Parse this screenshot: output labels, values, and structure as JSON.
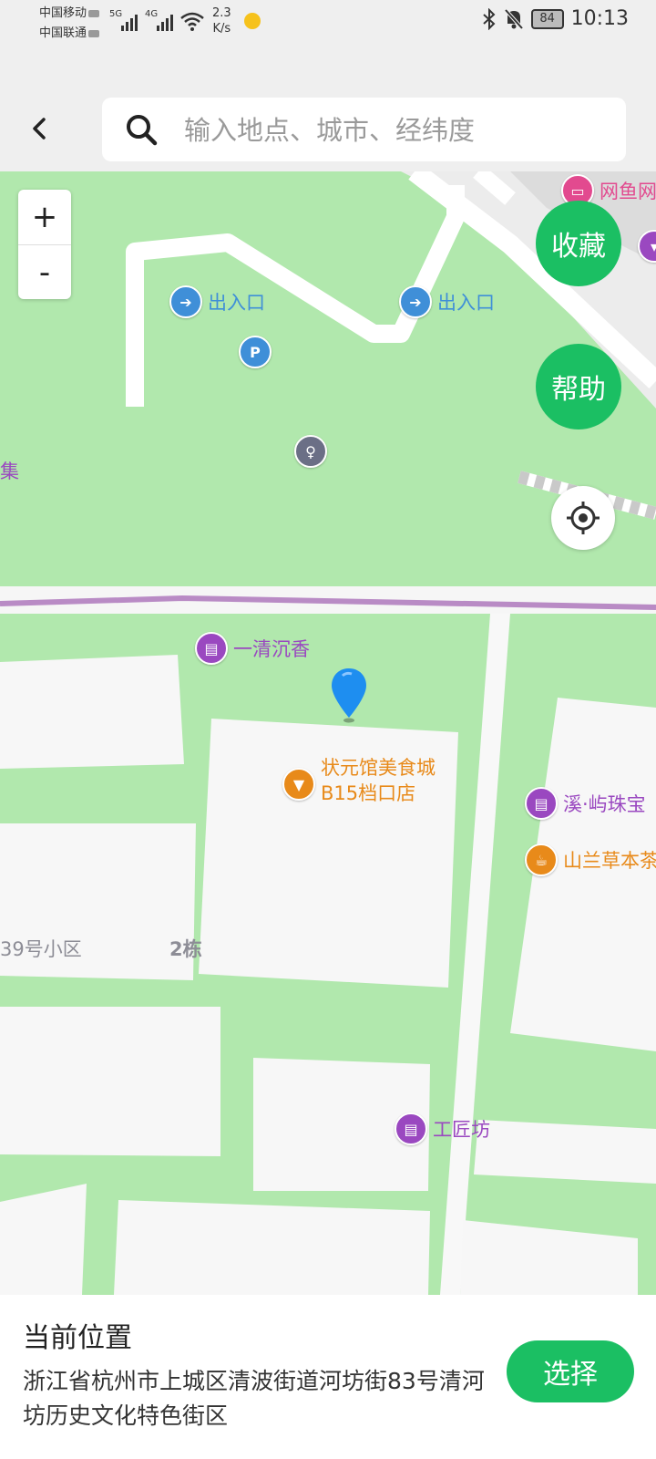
{
  "status_bar": {
    "carrier1": "中国移动",
    "carrier2": "中国联通",
    "sig1_label": "5G",
    "sig2_label": "4G",
    "speed_value": "2.3",
    "speed_unit": "K/s",
    "battery": "84",
    "time": "10:13"
  },
  "search": {
    "placeholder": "输入地点、城市、经纬度"
  },
  "map": {
    "zoom_in": "+",
    "zoom_out": "-",
    "favorite_label": "收藏",
    "help_label": "帮助",
    "pois": {
      "entrance1": "出入口",
      "entrance2": "出入口",
      "parking_glyph": "P",
      "market_partial": "集",
      "wangyu": "网鱼网",
      "yiqing": "一清沉香",
      "zhuangyuan_line1": "状元馆美食城",
      "zhuangyuan_line2": "B15档口店",
      "xiyu": "溪·屿珠宝",
      "shanlan": "山兰草本茶",
      "gongjiang": "工匠坊"
    },
    "labels": {
      "community": "39号小区",
      "building": "2栋"
    }
  },
  "bottom_panel": {
    "title": "当前位置",
    "address": "浙江省杭州市上城区清波街道河坊街83号清河坊历史文化特色街区",
    "select_label": "选择"
  },
  "colors": {
    "accent": "#1bbf63",
    "map_green": "#b1e8ad",
    "poi_blue": "#3f8fd8",
    "poi_purple": "#9a48c0",
    "poi_orange": "#e88a1a"
  }
}
